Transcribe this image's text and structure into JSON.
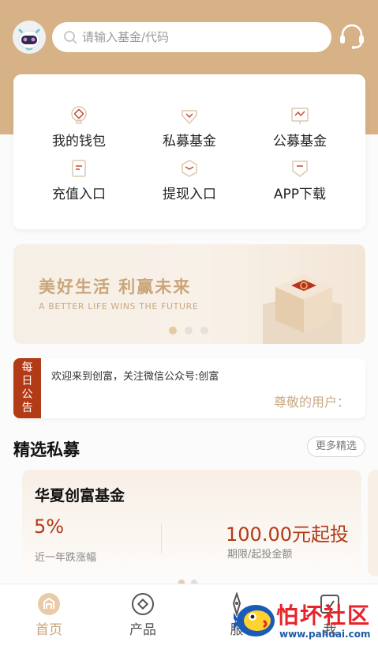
{
  "colors": {
    "brand_gold": "#d7b287",
    "accent_red": "#b23a16",
    "banner_text": "#caa57a"
  },
  "header": {
    "search_placeholder": "请输入基金/代码",
    "avatar_icon": "robot-avatar-icon",
    "support_icon": "headset-icon"
  },
  "quick_menu": [
    {
      "label": "我的钱包",
      "icon": "wallet-icon"
    },
    {
      "label": "私募基金",
      "icon": "private-fund-icon"
    },
    {
      "label": "公募基金",
      "icon": "public-fund-icon"
    },
    {
      "label": "充值入口",
      "icon": "recharge-icon"
    },
    {
      "label": "提现入口",
      "icon": "withdraw-icon"
    },
    {
      "label": "APP下载",
      "icon": "download-icon"
    }
  ],
  "banner": {
    "title": "美好生活 利赢未来",
    "subtitle": "A BETTER LIFE WINS THE FUTURE",
    "active_slide": 1,
    "slide_count": 3
  },
  "notice": {
    "tag_line1": "每",
    "tag_line2": "日",
    "tag_line3": "公",
    "tag_line4": "告",
    "text": "欢迎来到创富，关注微信公众号:创富",
    "greeting": "尊敬的用户："
  },
  "featured": {
    "title": "精选私募",
    "more_label": "更多精选",
    "fund": {
      "name": "华夏创富基金",
      "rate": "5%",
      "rate_label": "近一年跌涨幅",
      "amount": "100.00元起投",
      "amount_label": "期限/起投金额"
    }
  },
  "bottom_nav": [
    {
      "label": "首页",
      "icon": "home-icon",
      "active": true
    },
    {
      "label": "产品",
      "icon": "product-icon",
      "active": false
    },
    {
      "label": "服",
      "icon": "service-icon",
      "active": false
    },
    {
      "label": "我",
      "icon": "profile-icon",
      "active": false
    }
  ],
  "watermark": {
    "text": "怕坏社区",
    "url": "www.pahuai.com"
  }
}
